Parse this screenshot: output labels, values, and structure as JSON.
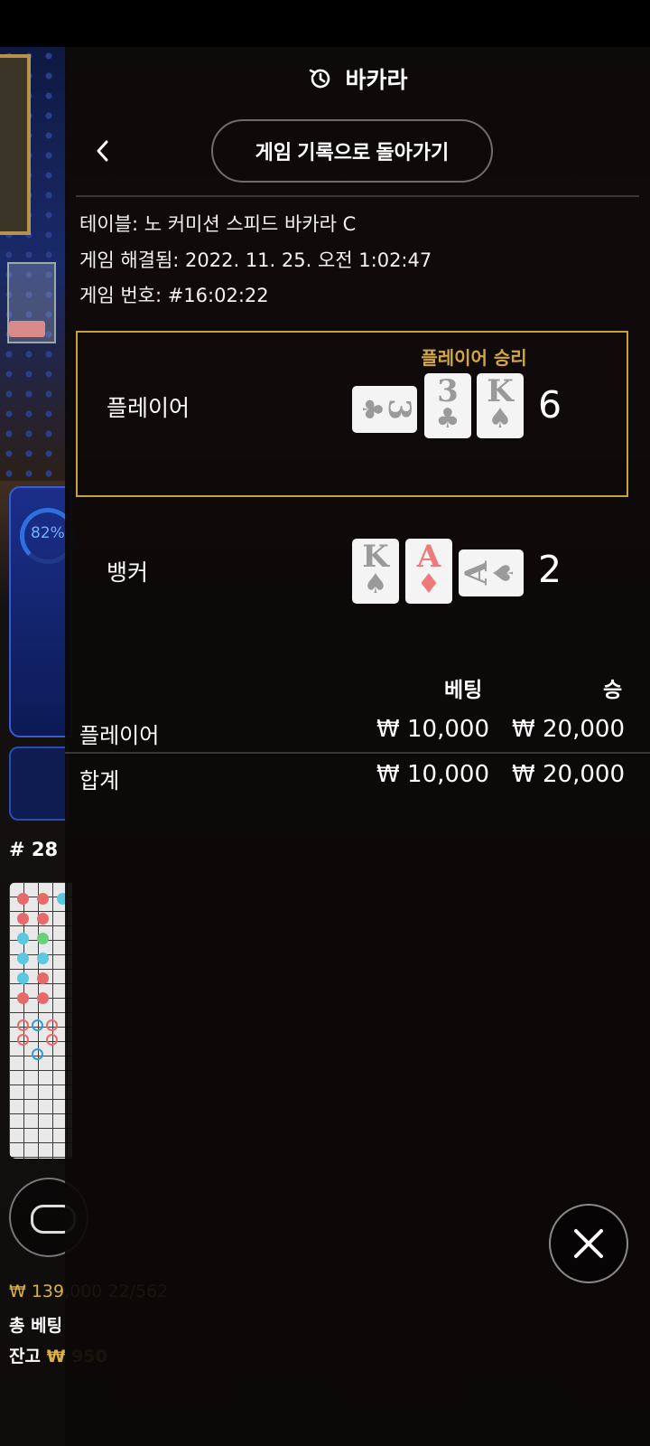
{
  "header": {
    "title": "바카라",
    "return_button": "게임 기록으로 돌아가기"
  },
  "info": {
    "table": "테이블: 노 커미션 스피드 바카라 C",
    "resolved": "게임 해결됨: 2022. 11. 25. 오전 1:02:47",
    "game_number": "게임 번호: #16:02:22"
  },
  "player": {
    "label": "플레이어",
    "result": "플레이어 승리",
    "score": "6",
    "cards": [
      {
        "rank": "3",
        "suit": "♣",
        "orientation": "horizontal",
        "color": "#9a9a9a"
      },
      {
        "rank": "3",
        "suit": "♣",
        "orientation": "vertical",
        "color": "#9a9a9a"
      },
      {
        "rank": "K",
        "suit": "♠",
        "orientation": "vertical",
        "color": "#9a9a9a"
      }
    ]
  },
  "banker": {
    "label": "뱅커",
    "score": "2",
    "cards": [
      {
        "rank": "K",
        "suit": "♠",
        "orientation": "vertical",
        "color": "#9a9a9a"
      },
      {
        "rank": "A",
        "suit": "♦",
        "orientation": "vertical",
        "color": "#ef7a7a"
      },
      {
        "rank": "A",
        "suit": "♠",
        "orientation": "horizontal",
        "color": "#9a9a9a"
      }
    ]
  },
  "bets": {
    "col_bet": "베팅",
    "col_win": "승",
    "rows": [
      {
        "label": "플레이어",
        "bet": "₩ 10,000",
        "win": "₩ 20,000"
      }
    ],
    "total": {
      "label": "합계",
      "bet": "₩ 10,000",
      "win": "₩ 20,000"
    }
  },
  "background": {
    "percent": "82%",
    "round": "# 28",
    "balance_line1": "₩ 139,000 22/562",
    "balance_line2": "총 베팅",
    "balance_line3_label": "잔고",
    "balance_line3_value": "₩ 950"
  },
  "icons": {
    "history": "history-icon",
    "back": "chevron-left-icon",
    "close": "close-icon"
  },
  "colors": {
    "accent_gold": "#c8a23e",
    "panel_bg": "#0c0808",
    "red_suit": "#ef7a7a",
    "black_suit": "#9a9a9a"
  }
}
